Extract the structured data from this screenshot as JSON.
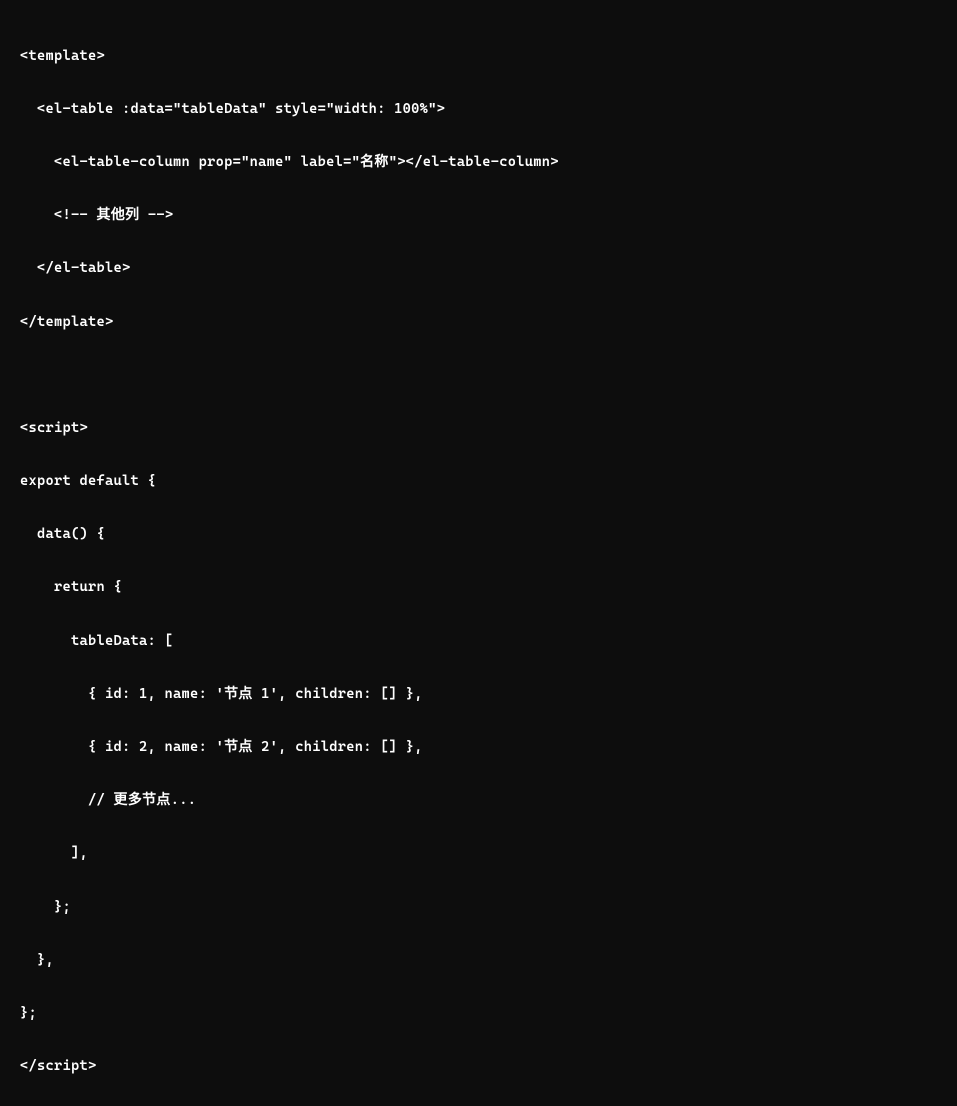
{
  "code": {
    "lines": [
      "<template>",
      "  <el-table :data=\"tableData\" style=\"width: 100%\">",
      "    <el-table-column prop=\"name\" label=\"名称\"></el-table-column>",
      "    <!-- 其他列 -->",
      "  </el-table>",
      "</template>",
      "",
      "<script>",
      "export default {",
      "  data() {",
      "    return {",
      "      tableData: [",
      "        { id: 1, name: '节点 1', children: [] },",
      "        { id: 2, name: '节点 2', children: [] },",
      "        // 更多节点...",
      "      ],",
      "    };",
      "  },",
      "};",
      "</script>"
    ]
  },
  "colors": {
    "background": "#0d0d0d",
    "text": "#ffffff"
  }
}
